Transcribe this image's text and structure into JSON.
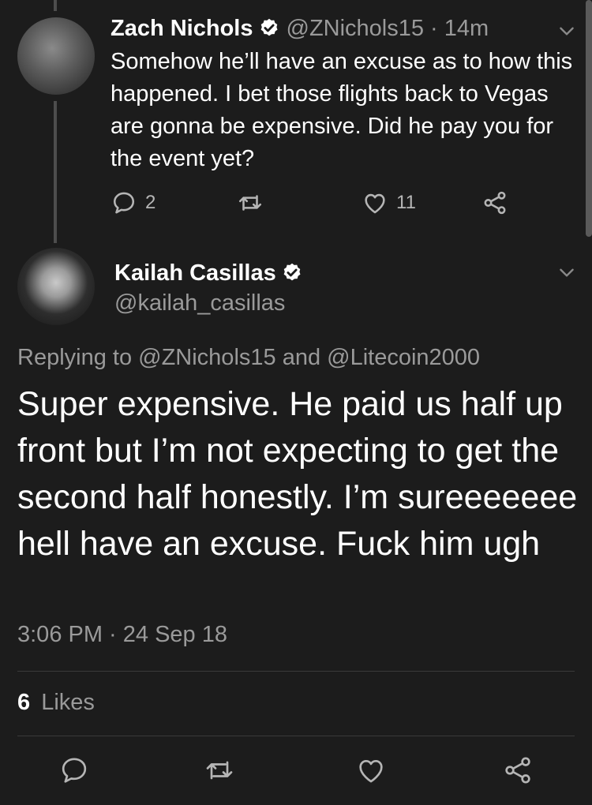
{
  "reply": {
    "display_name": "Zach Nichols",
    "handle_time": "@ZNichols15 · 14m",
    "text": "Somehow he’ll have an excuse as to how this happened. I bet those flights back to Vegas are gonna be expensive. Did he pay you for the event yet?",
    "reply_count": "2",
    "like_count": "11"
  },
  "tweet": {
    "display_name": "Kailah Casillas",
    "handle": "@kailah_casillas",
    "replying_to": "Replying to @ZNichols15 and @Litecoin2000",
    "text": "Super expensive. He paid us half up front but I’m not expecting to get the second half honestly. I’m sureeeeeee hell have an excuse. Fuck him ugh",
    "timestamp": "3:06 PM · 24 Sep 18",
    "likes_count": "6",
    "likes_label": "Likes"
  },
  "icons": {
    "verified": "verified-badge-icon",
    "menu": "chevron-down-icon",
    "reply": "reply-icon",
    "retweet": "retweet-icon",
    "like": "heart-icon",
    "share": "share-icon"
  },
  "colors": {
    "background": "#1c1c1c",
    "text_primary": "#ffffff",
    "text_secondary": "#9a9a9a",
    "icon": "#b5b5b5",
    "divider": "#3a3a3a"
  }
}
